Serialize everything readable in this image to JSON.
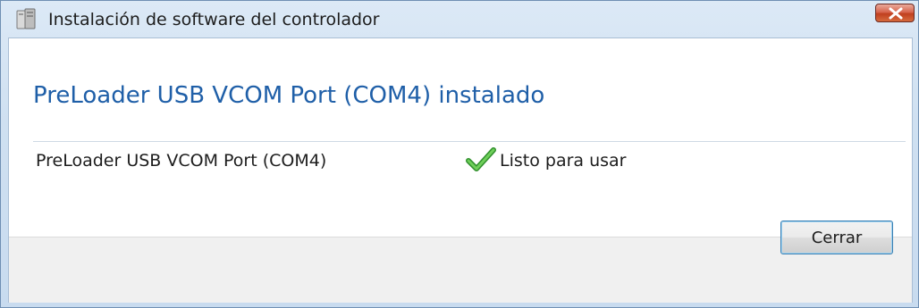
{
  "window": {
    "title": "Instalación de software del controlador",
    "close_icon": "close-icon"
  },
  "content": {
    "heading": "PreLoader USB VCOM Port (COM4) instalado",
    "devices": [
      {
        "name": "PreLoader USB VCOM Port (COM4)",
        "status": "Listo para usar",
        "status_icon": "checkmark-icon"
      }
    ]
  },
  "footer": {
    "close_label": "Cerrar"
  },
  "colors": {
    "heading": "#1f5fa8",
    "close_button": "#c8462a",
    "checkmark": "#3aa835",
    "footer_bg": "#f0f0f0"
  }
}
